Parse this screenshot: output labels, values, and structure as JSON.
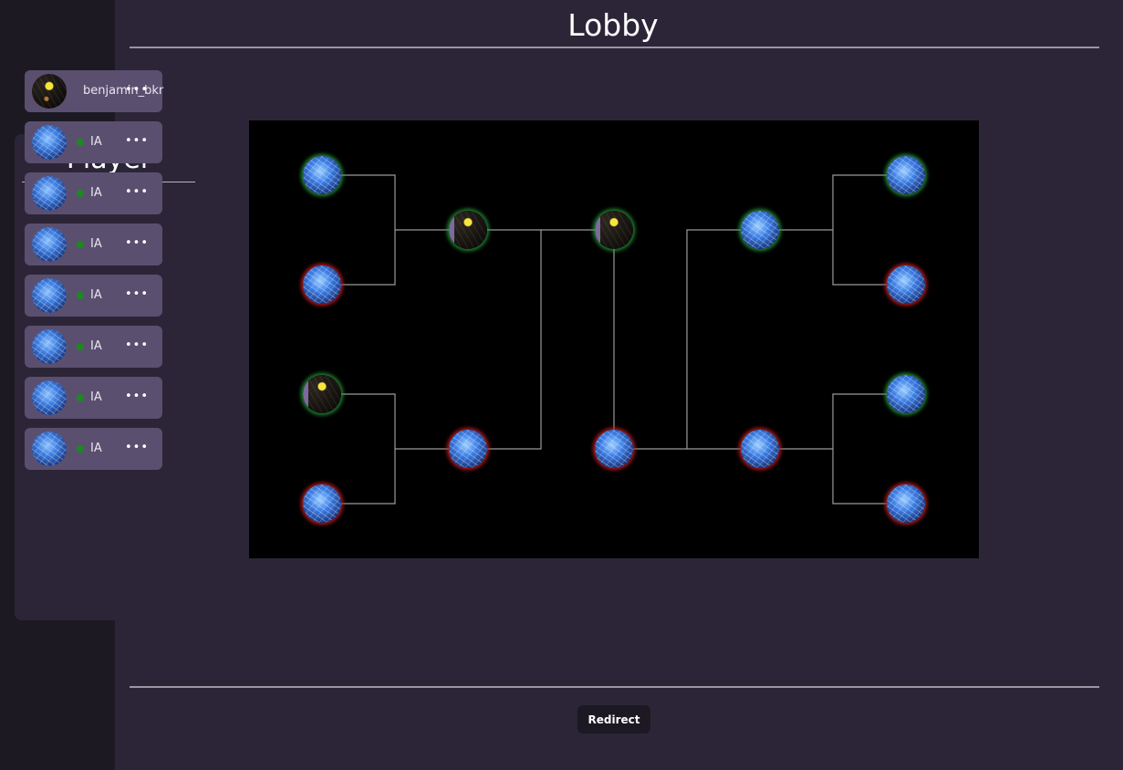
{
  "page": {
    "title": "Lobby"
  },
  "players_panel": {
    "title": "Player",
    "players": [
      {
        "name": "benjamin_bkr",
        "avatar": "user-avatar",
        "status": "",
        "more_icon": "ellipsis-icon"
      },
      {
        "name": "IA",
        "avatar": "ai-avatar",
        "status": "online",
        "more_icon": "ellipsis-icon"
      },
      {
        "name": "IA",
        "avatar": "ai-avatar",
        "status": "online",
        "more_icon": "ellipsis-icon"
      },
      {
        "name": "IA",
        "avatar": "ai-avatar",
        "status": "online",
        "more_icon": "ellipsis-icon"
      },
      {
        "name": "IA",
        "avatar": "ai-avatar",
        "status": "online",
        "more_icon": "ellipsis-icon"
      },
      {
        "name": "IA",
        "avatar": "ai-avatar",
        "status": "online",
        "more_icon": "ellipsis-icon"
      },
      {
        "name": "IA",
        "avatar": "ai-avatar",
        "status": "online",
        "more_icon": "ellipsis-icon"
      },
      {
        "name": "IA",
        "avatar": "ai-avatar",
        "status": "online",
        "more_icon": "ellipsis-icon"
      }
    ],
    "more_glyph": "•••"
  },
  "bracket": {
    "rounds": [
      {
        "matches": [
          {
            "top": {
              "avatar": "ai-avatar",
              "result": "win"
            },
            "bottom": {
              "avatar": "ai-avatar",
              "result": "lose"
            }
          },
          {
            "top": {
              "avatar": "user-avatar",
              "result": "win"
            },
            "bottom": {
              "avatar": "ai-avatar",
              "result": "lose"
            }
          },
          {
            "top": {
              "avatar": "ai-avatar",
              "result": "win"
            },
            "bottom": {
              "avatar": "ai-avatar",
              "result": "lose"
            }
          },
          {
            "top": {
              "avatar": "ai-avatar",
              "result": "win"
            },
            "bottom": {
              "avatar": "ai-avatar",
              "result": "lose"
            }
          }
        ]
      },
      {
        "matches": [
          {
            "top": {
              "avatar": "user-avatar",
              "result": "win"
            },
            "bottom": {
              "avatar": "ai-avatar",
              "result": "lose"
            }
          },
          {
            "top": {
              "avatar": "ai-avatar",
              "result": "win"
            },
            "bottom": {
              "avatar": "ai-avatar",
              "result": "lose"
            }
          }
        ]
      },
      {
        "matches": [
          {
            "top": {
              "avatar": "user-avatar",
              "result": "win"
            },
            "bottom": {
              "avatar": "ai-avatar",
              "result": "lose"
            }
          }
        ]
      }
    ],
    "colors": {
      "win_glow": "#28a03c",
      "lose_glow": "#c81e1e",
      "line": "#9a9a9a",
      "background": "#000000"
    }
  },
  "footer": {
    "redirect_label": "Redirect"
  },
  "colors": {
    "background": "#2c2537",
    "sidebar": "#1c1923",
    "card": "#5b4f70",
    "status_online": "#1a8a1f"
  }
}
